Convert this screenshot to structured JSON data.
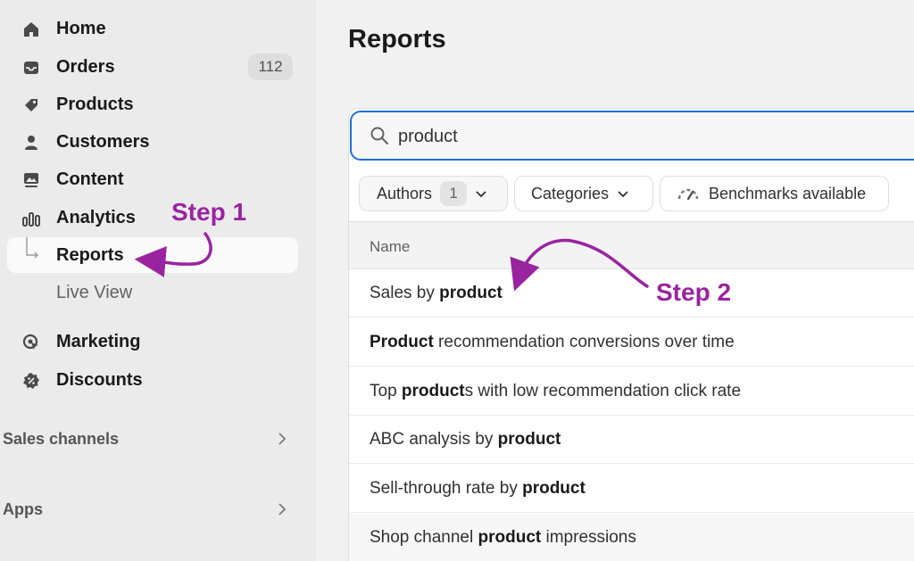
{
  "sidebar": {
    "items": [
      {
        "label": "Home",
        "icon": "home-icon"
      },
      {
        "label": "Orders",
        "icon": "inbox-icon",
        "badge": "112"
      },
      {
        "label": "Products",
        "icon": "tag-icon"
      },
      {
        "label": "Customers",
        "icon": "person-icon"
      },
      {
        "label": "Content",
        "icon": "image-icon"
      },
      {
        "label": "Analytics",
        "icon": "bar-chart-icon"
      },
      {
        "label": "Reports",
        "icon": "sub-arrow-icon",
        "active": true
      },
      {
        "label": "Live View"
      },
      {
        "label": "Marketing",
        "icon": "target-icon"
      },
      {
        "label": "Discounts",
        "icon": "discount-icon"
      }
    ],
    "sections": [
      {
        "label": "Sales channels"
      },
      {
        "label": "Apps"
      }
    ]
  },
  "main": {
    "title": "Reports",
    "search": {
      "value": "product"
    },
    "filters": {
      "authors": {
        "label": "Authors",
        "count": "1"
      },
      "categories": {
        "label": "Categories"
      },
      "benchmarks": {
        "label": "Benchmarks available"
      }
    },
    "table": {
      "header": "Name",
      "rows": [
        {
          "pre": "Sales by ",
          "bold": "product",
          "post": ""
        },
        {
          "pre": "",
          "bold": "Product",
          "post": " recommendation conversions over time"
        },
        {
          "pre": "Top ",
          "bold": "product",
          "post": "s with low recommendation click rate"
        },
        {
          "pre": "ABC analysis by ",
          "bold": "product",
          "post": ""
        },
        {
          "pre": "Sell-through rate by ",
          "bold": "product",
          "post": ""
        },
        {
          "pre": "Shop channel ",
          "bold": "product",
          "post": " impressions"
        }
      ]
    }
  },
  "annotations": {
    "step1": "Step 1",
    "step2": "Step 2",
    "color": "#9a23a0"
  },
  "colors": {
    "search_border": "#1f6fd6",
    "sidebar_bg": "#ebebeb",
    "page_bg": "#f1f1f1"
  }
}
